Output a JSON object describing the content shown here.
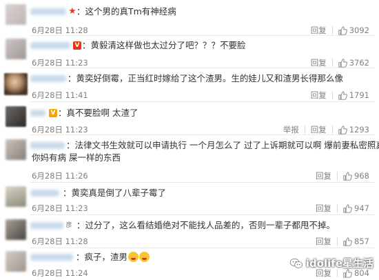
{
  "comments": [
    {
      "text": "：这个男的真Tm有神经病",
      "time": "6月28日 11:28",
      "reply": "回复",
      "likes": "3092"
    },
    {
      "text": "：黄毅清这样做也太过分了吧？？？不要脸",
      "time": "6月28日 11:23",
      "reply": "回复",
      "likes": "3762"
    },
    {
      "text": "：黄奕好倒霉，正当红时嫁给了这个渣男。生的娃儿又和渣男长得那么像",
      "time": "6月28日 11:41",
      "reply": "回复",
      "likes": "1791"
    },
    {
      "text": "：真不要脸啊 太渣了",
      "time": "6月28日 11:23",
      "report": "举报",
      "reply": "回复",
      "likes": "1293"
    },
    {
      "text_line1": "：法律文书生效就可以申请执行 一个月怎么了 过了上诉期就可以啊 爆前妻私密照真",
      "text_line2": "你妈有病 屎一样的东西",
      "time": "6月28日 11:26",
      "reply": "回复",
      "likes": "968"
    },
    {
      "text": "：黄奕真是倒了八辈子霉了",
      "time": "6月28日 11:23",
      "reply": "回复",
      "likes": "947"
    },
    {
      "text": "：过分了，这么看结婚绝对不能找人品差的，否则一辈子都甩不掉。",
      "time": "6月28日 11:28",
      "reply": "回复",
      "likes": "857"
    },
    {
      "text": "：疯子，渣男",
      "time": "6月28日 11:24",
      "reply": "回复",
      "likes": "804"
    }
  ],
  "watermark": "idolife星生活",
  "colors": {
    "badge_red": "#e8350e",
    "badge_gold": "#f6a400",
    "text_gray": "#808080"
  },
  "icons": [
    "thumbs-up-icon",
    "wechat-icon",
    "vip-badge-icon",
    "star-icon",
    "laughing-emoji-icon"
  ]
}
